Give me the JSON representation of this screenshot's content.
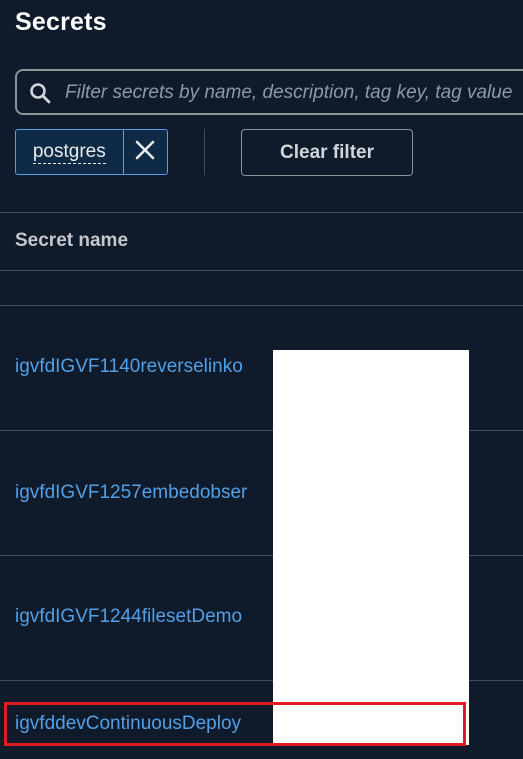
{
  "page": {
    "title": "Secrets"
  },
  "search": {
    "placeholder": "Filter secrets by name, description, tag key, tag value"
  },
  "filter_token": {
    "value": "postgres"
  },
  "toolbar": {
    "clear_filter_label": "Clear filter"
  },
  "table": {
    "columns": [
      "Secret name"
    ],
    "rows": [
      {
        "name": "igvfdIGVF1140reverselinko"
      },
      {
        "name": "igvfdIGVF1257embedobser"
      },
      {
        "name": "igvfdIGVF1244filesetDemo"
      },
      {
        "name": "igvfddevContinuousDeploy"
      }
    ]
  },
  "colors": {
    "background": "#0f1b2a",
    "link": "#539fe5",
    "highlight": "#e01b24",
    "redaction": "#ffffff"
  }
}
